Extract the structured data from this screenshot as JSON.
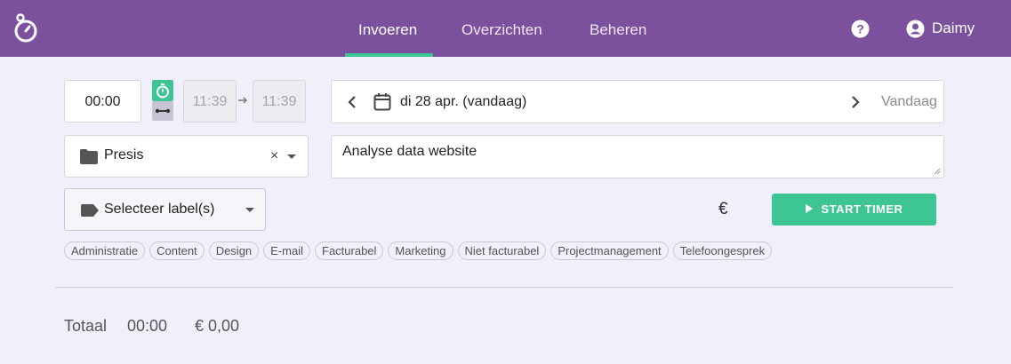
{
  "nav": {
    "items": [
      {
        "label": "Invoeren",
        "active": true
      },
      {
        "label": "Overzichten",
        "active": false
      },
      {
        "label": "Beheren",
        "active": false
      }
    ],
    "user": "Daimy",
    "accent": "#7b519d",
    "active_underline": "#3dc694"
  },
  "timer": {
    "duration": "00:00",
    "start_time": "11:39",
    "end_time": "11:39",
    "mode_icons": [
      "stopwatch-icon",
      "manual-range-icon"
    ]
  },
  "date": {
    "label": "di 28 apr. (vandaag)",
    "today_label": "Vandaag"
  },
  "project": {
    "selected": "Presis",
    "clear": "×"
  },
  "description": {
    "value": "Analyse data website"
  },
  "labels": {
    "select_placeholder": "Selecteer label(s)",
    "suggestions": [
      "Administratie",
      "Content",
      "Design",
      "E-mail",
      "Facturabel",
      "Marketing",
      "Niet facturabel",
      "Projectmanagement",
      "Telefoongesprek"
    ]
  },
  "billing": {
    "currency_symbol": "€"
  },
  "start_button": {
    "label": "START TIMER",
    "color": "#3dc694"
  },
  "totals": {
    "label": "Totaal",
    "time": "00:00",
    "amount": "€ 0,00"
  }
}
